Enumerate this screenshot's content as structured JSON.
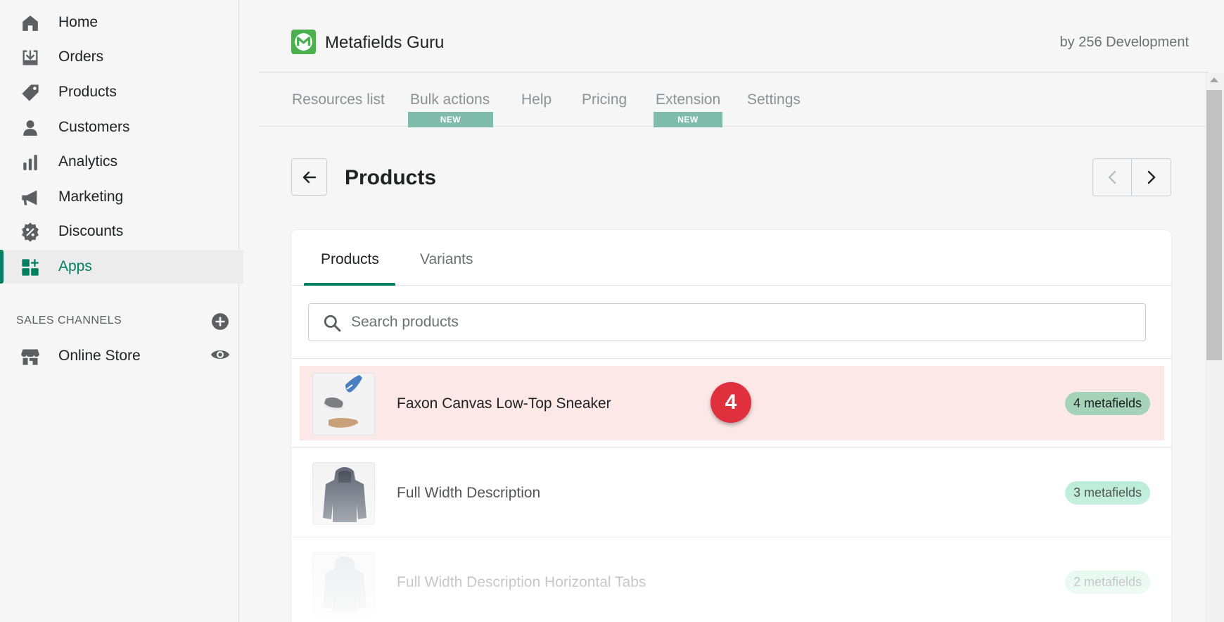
{
  "sidebar": {
    "items": [
      {
        "label": "Home",
        "icon": "home-icon"
      },
      {
        "label": "Orders",
        "icon": "orders-icon"
      },
      {
        "label": "Products",
        "icon": "tag-icon"
      },
      {
        "label": "Customers",
        "icon": "person-icon"
      },
      {
        "label": "Analytics",
        "icon": "bar-chart-icon"
      },
      {
        "label": "Marketing",
        "icon": "megaphone-icon"
      },
      {
        "label": "Discounts",
        "icon": "discount-icon"
      },
      {
        "label": "Apps",
        "icon": "apps-icon",
        "active": true
      }
    ],
    "sales_channels_title": "SALES CHANNELS",
    "channels": [
      {
        "label": "Online Store",
        "icon": "store-icon"
      }
    ]
  },
  "app": {
    "name": "Metafields Guru",
    "by": "by 256 Development",
    "tabs": [
      {
        "label": "Resources list"
      },
      {
        "label": "Bulk actions",
        "badge": "NEW"
      },
      {
        "label": "Help"
      },
      {
        "label": "Pricing"
      },
      {
        "label": "Extension",
        "badge": "NEW"
      },
      {
        "label": "Settings"
      }
    ]
  },
  "page": {
    "title": "Products",
    "card_tabs": [
      {
        "label": "Products",
        "active": true
      },
      {
        "label": "Variants"
      }
    ],
    "search_placeholder": "Search products",
    "rows": [
      {
        "name": "Faxon Canvas Low-Top Sneaker",
        "metafields": "4 metafields",
        "highlight": true
      },
      {
        "name": "Full Width Description",
        "metafields": "3 metafields"
      },
      {
        "name": "Full Width Description Horizontal Tabs",
        "metafields": "2 metafields"
      }
    ]
  },
  "step_badge": "4",
  "colors": {
    "accent": "#008060",
    "highlight": "#fde8e8",
    "badge": "#aee9d1",
    "new_badge": "#7fbcaa",
    "step": "#e0303e"
  }
}
